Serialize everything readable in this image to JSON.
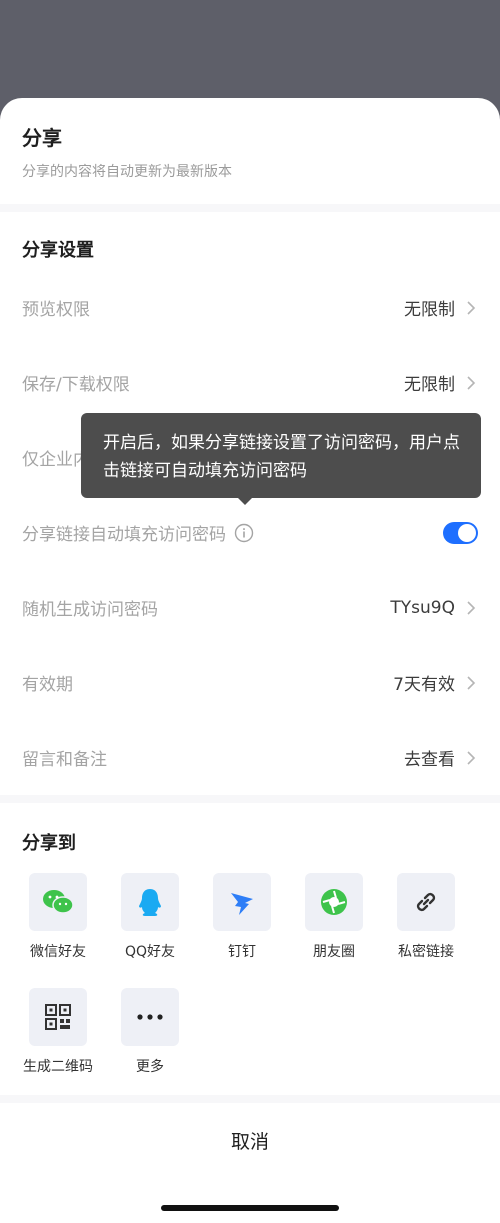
{
  "header": {
    "title": "分享",
    "subtitle": "分享的内容将自动更新为最新版本"
  },
  "settings": {
    "section_title": "分享设置",
    "rows": [
      {
        "label": "预览权限",
        "value": "无限制"
      },
      {
        "label": "保存/下载权限",
        "value": "无限制"
      },
      {
        "label": "仅企业内",
        "value": ""
      },
      {
        "label": "分享链接自动填充访问密码",
        "value": "",
        "toggle_on": true
      },
      {
        "label": "随机生成访问密码",
        "value": "TYsu9Q"
      },
      {
        "label": "有效期",
        "value": "7天有效"
      },
      {
        "label": "留言和备注",
        "value": "去查看"
      }
    ]
  },
  "tooltip": {
    "text": "开启后，如果分享链接设置了访问密码，用户点击链接可自动填充访问密码"
  },
  "share_to": {
    "title": "分享到",
    "items": [
      {
        "label": "微信好友",
        "icon": "wechat-icon"
      },
      {
        "label": "QQ好友",
        "icon": "qq-icon"
      },
      {
        "label": "钉钉",
        "icon": "dingtalk-icon"
      },
      {
        "label": "朋友圈",
        "icon": "moments-icon"
      },
      {
        "label": "私密链接",
        "icon": "link-icon"
      },
      {
        "label": "生成二维码",
        "icon": "qrcode-icon"
      },
      {
        "label": "更多",
        "icon": "more-icon"
      }
    ]
  },
  "cancel_label": "取消",
  "colors": {
    "accent": "#1e6fff",
    "backdrop": "#5e5f69",
    "tooltip_bg": "#4d4d4d"
  }
}
